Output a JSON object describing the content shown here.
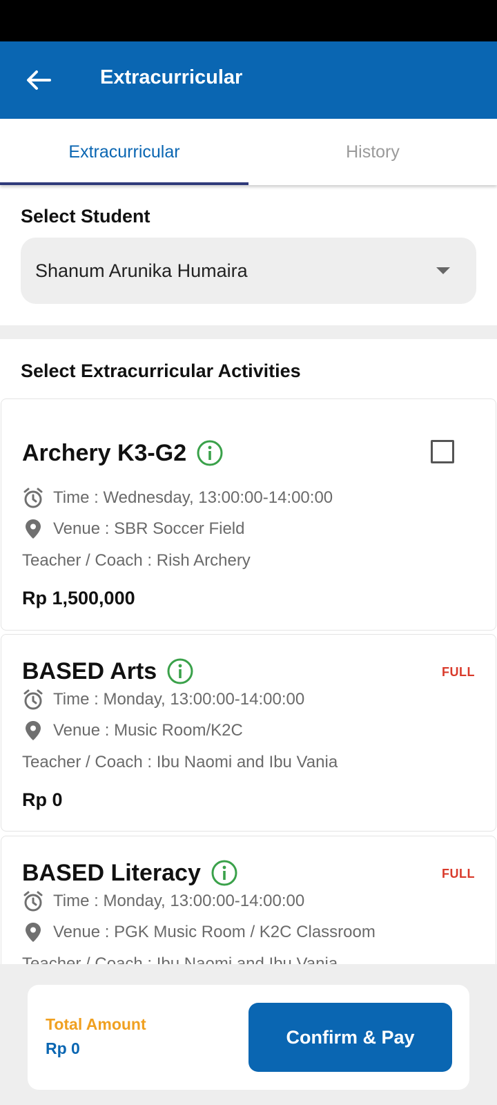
{
  "app_bar": {
    "title": "Extracurricular"
  },
  "tabs": [
    {
      "label": "Extracurricular",
      "active": true
    },
    {
      "label": "History",
      "active": false
    }
  ],
  "student": {
    "section_label": "Select Student",
    "selected": "Shanum Arunika Humaira"
  },
  "activities": {
    "section_label": "Select Extracurricular Activities",
    "items": [
      {
        "name": "Archery K3-G2",
        "time": "Time : Wednesday, 13:00:00-14:00:00",
        "venue": "Venue : SBR Soccer Field",
        "teacher": "Teacher / Coach : Rish Archery",
        "price": "Rp 1,500,000",
        "status": ""
      },
      {
        "name": "BASED Arts",
        "time": "Time : Monday, 13:00:00-14:00:00",
        "venue": "Venue : Music Room/K2C",
        "teacher": "Teacher / Coach : Ibu Naomi and Ibu Vania",
        "price": "Rp 0",
        "status": "FULL"
      },
      {
        "name": "BASED Literacy",
        "time": "Time : Monday, 13:00:00-14:00:00",
        "venue": "Venue : PGK Music Room / K2C Classroom",
        "teacher": "Teacher / Coach : Ibu Naomi and Ibu Vania",
        "price": "",
        "status": "FULL"
      }
    ]
  },
  "footer": {
    "total_label": "Total Amount",
    "total_value": "Rp 0",
    "pay_button": "Confirm & Pay"
  },
  "colors": {
    "primary": "#0a66b2",
    "full": "#d93a2b",
    "info": "#3aa14a",
    "total_label": "#f0a020"
  }
}
